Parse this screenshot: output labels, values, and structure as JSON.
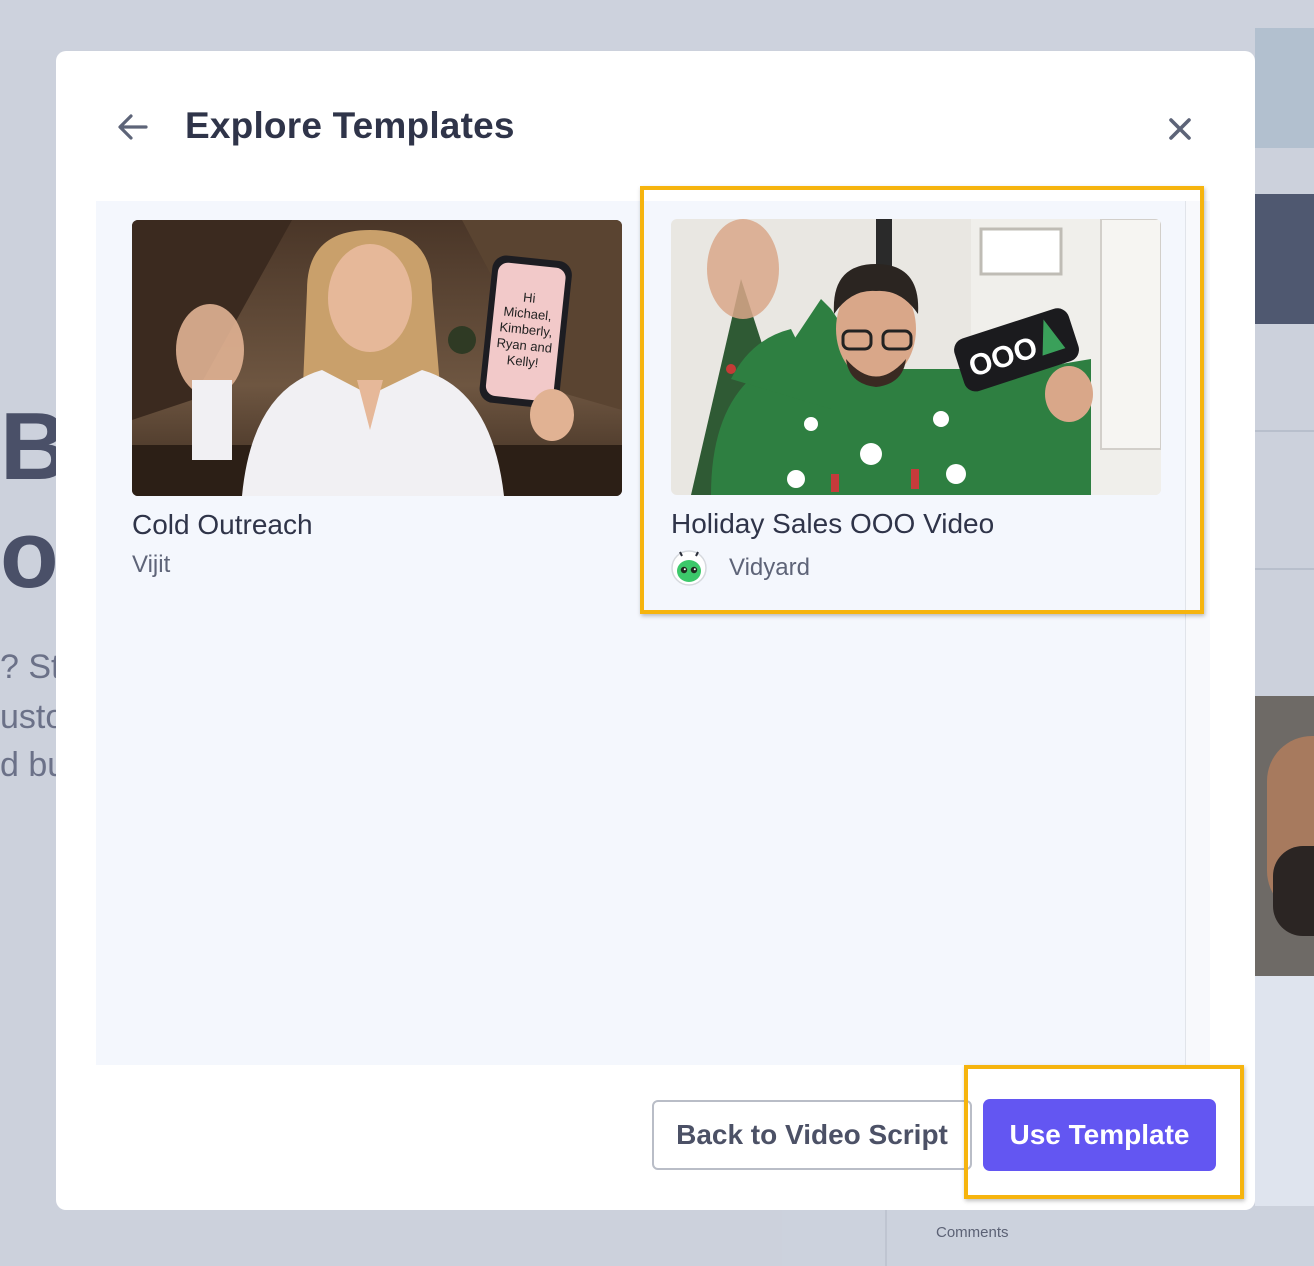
{
  "modal": {
    "title": "Explore Templates"
  },
  "templates": [
    {
      "title": "Cold Outreach",
      "author": "Vijit",
      "phone_text": "Hi Michael, Kimberly, Ryan and Kelly!"
    },
    {
      "title": "Holiday Sales OOO Video",
      "author": "Vidyard",
      "phone_text": "OOO",
      "selected": true
    }
  ],
  "footer": {
    "back_label": "Back to Video Script",
    "use_label": "Use Template"
  },
  "background": {
    "comments_label": "Comments",
    "partial_heading_1": "Bu",
    "partial_heading_2": "or",
    "partial_line_1": "? Sta",
    "partial_line_2": "usto",
    "partial_line_3": "d bu"
  },
  "colors": {
    "primary": "#6356f2",
    "highlight": "#f6b40e",
    "title_text": "#2f3449",
    "panel_bg": "#f4f7fd"
  },
  "icons": {
    "back": "arrow-left-icon",
    "close": "close-icon",
    "vidyard_avatar": "vidyard-bot-icon"
  }
}
